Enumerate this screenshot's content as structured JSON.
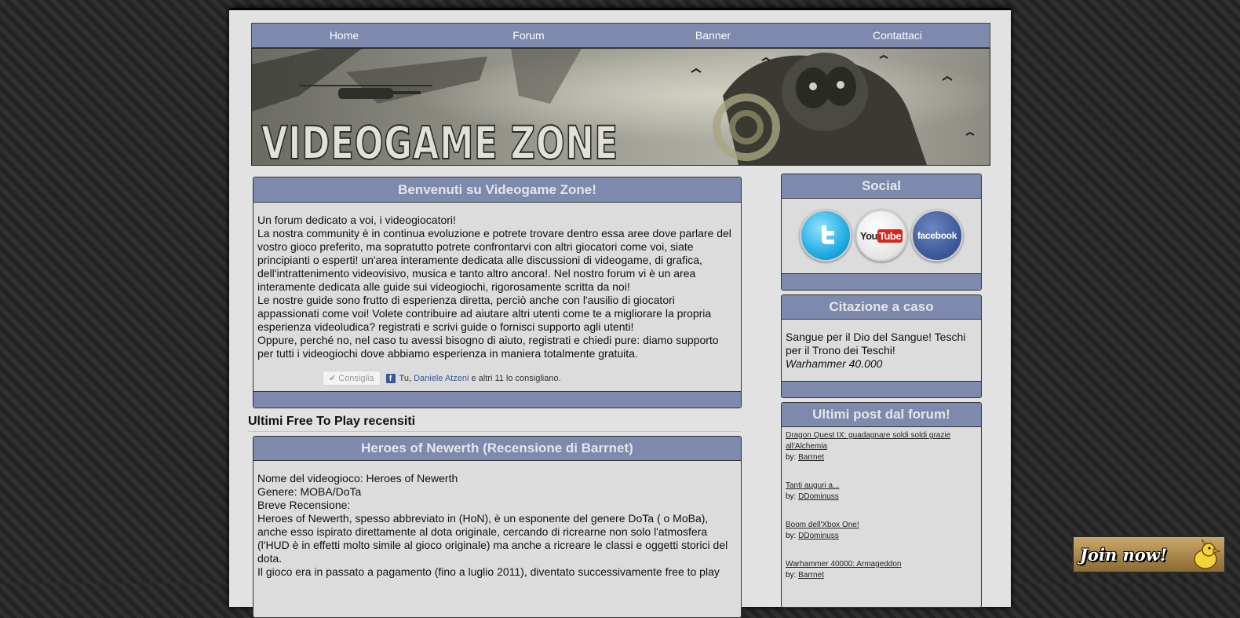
{
  "nav": [
    "Home",
    "Forum",
    "Banner",
    "Contattaci"
  ],
  "banner": {
    "logo_text": "VIDEOGAME ZONE"
  },
  "welcome": {
    "title": "Benvenuti su Videogame Zone!",
    "paragraphs": [
      "Un forum dedicato a voi, i videogiocatori!",
      "La nostra community è in continua evoluzione e potrete trovare dentro essa aree dove parlare del vostro gioco preferito, ma sopratutto potrete confrontarvi con altri giocatori come voi, siate principianti o esperti! un'area interamente dedicata alle discussioni di videogame, di grafica, dell'intrattenimento videovisivo, musica e tanto altro ancora!. Nel nostro forum vi è un area interamente dedicata alle guide sui videogiochi, rigorosamente scritta da noi!",
      "Le nostre guide sono frutto di esperienza diretta, perciò anche con l'ausilio di giocatori appassionati come voi! Volete contribuire ad aiutare altri utenti come te a migliorare la propria esperienza videoludica? registrati e scrivi guide o fornisci supporto agli utenti!",
      "Oppure, perché no, nel caso tu avessi bisogno di aiuto, registrati e chiedi pure: diamo supporto per tutti i videogiochi dove abbiamo esperienza in maniera totalmente gratuita."
    ],
    "like_button": "Consiglia",
    "like_prefix": "Tu,",
    "like_name": "Daniele Atzeni",
    "like_suffix": "e altri 11 lo consigliano."
  },
  "section_title": "Ultimi Free To Play recensiti",
  "review": {
    "title": "Heroes of Newerth (Recensione di Barrnet)",
    "lines": [
      "Nome del videogioco: Heroes of Newerth",
      "Genere: MOBA/DoTa",
      "Breve Recensione:",
      "Heroes of Newerth, spesso abbreviato in (HoN), è un esponente del genere DoTa ( o MoBa), anche esso ispirato direttamente al dota originale, cercando di ricrearne non solo l'atmosfera (l'HUD è in effetti molto simile al gioco originale) ma anche a ricreare le classi e oggetti storici del dota.",
      "Il gioco era in passato a pagamento (fino a luglio 2011), diventato successivamente free to play"
    ]
  },
  "social": {
    "title": "Social",
    "youtube_you": "You",
    "youtube_tube": "Tube",
    "facebook_label": "facebook"
  },
  "quote": {
    "title": "Citazione a caso",
    "text": "Sangue per il Dio del Sangue! Teschi per il Trono dei Teschi!",
    "source": "Warhammer 40.000"
  },
  "posts": {
    "title": "Ultimi post dal forum!",
    "by_label": "by:",
    "items": [
      {
        "title": "Dragon Quest IX: guadagnare soldi soldi grazie all'Alchemia",
        "author": "Barrnet"
      },
      {
        "title": "Tanti auguri a...",
        "author": "DDominuss"
      },
      {
        "title": "Boom dell'Xbox One!",
        "author": "DDominuss"
      },
      {
        "title": "Warhammer 40000: Armageddon",
        "author": "Barrnet"
      }
    ]
  },
  "join": {
    "label": "Join now!"
  },
  "colors": {
    "header_bar": "#7d8aae",
    "panel": "#dcdcdc",
    "page": "#e2e2e2"
  }
}
